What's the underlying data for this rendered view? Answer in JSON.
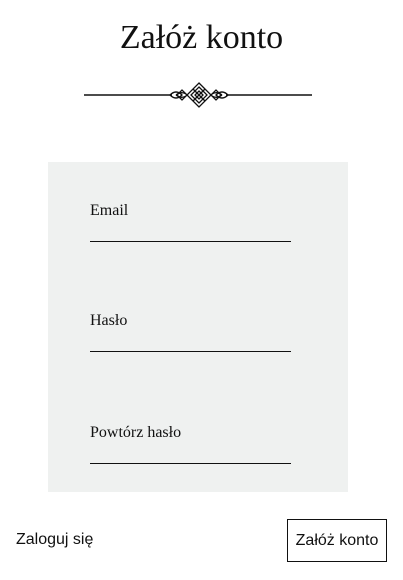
{
  "header": {
    "title": "Załóż konto"
  },
  "ornament": {
    "icon": "decorative-flourish-divider",
    "color": "#111111"
  },
  "form": {
    "background": "#eff1f0",
    "fields": [
      {
        "label": "Email",
        "value": ""
      },
      {
        "label": "Hasło",
        "value": ""
      },
      {
        "label": "Powtórz hasło",
        "value": ""
      }
    ]
  },
  "footer": {
    "login_label": "Zaloguj się",
    "submit_label": "Załóż konto"
  }
}
